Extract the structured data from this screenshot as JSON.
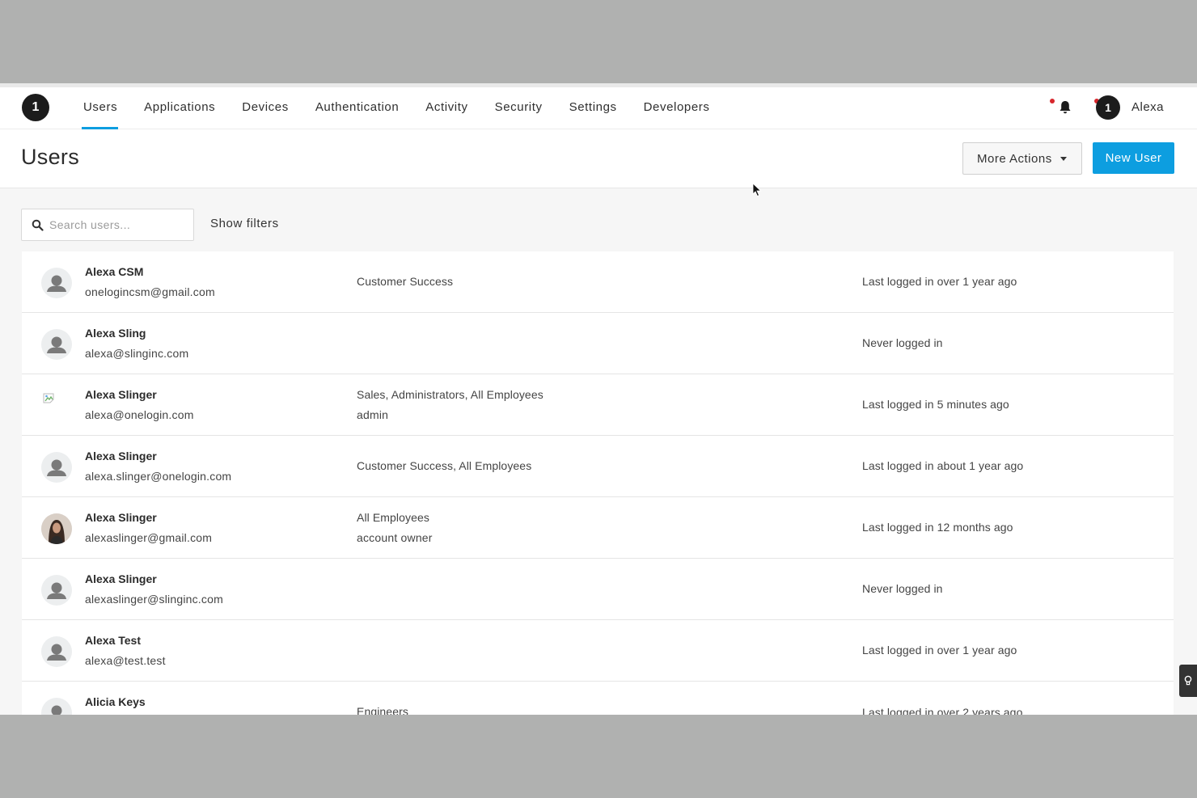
{
  "nav": {
    "logo": "1",
    "tabs": [
      {
        "label": "Users"
      },
      {
        "label": "Applications"
      },
      {
        "label": "Devices"
      },
      {
        "label": "Authentication"
      },
      {
        "label": "Activity"
      },
      {
        "label": "Security"
      },
      {
        "label": "Settings"
      },
      {
        "label": "Developers"
      }
    ],
    "active_tab": "Users",
    "user_avatar": "1",
    "user_name": "Alexa"
  },
  "header": {
    "title": "Users",
    "more_actions_label": "More Actions",
    "new_user_label": "New User"
  },
  "search": {
    "placeholder": "Search users...",
    "value": ""
  },
  "filters": {
    "label": "Show filters"
  },
  "users": [
    {
      "name": "Alexa CSM",
      "email": "onelogincsm@gmail.com",
      "groups": "Customer Success",
      "role": "",
      "login": "Last logged in over 1 year ago",
      "avatar": "placeholder"
    },
    {
      "name": "Alexa Sling",
      "email": "alexa@slinginc.com",
      "groups": "",
      "role": "",
      "login": "Never logged in",
      "avatar": "placeholder"
    },
    {
      "name": "Alexa Slinger",
      "email": "alexa@onelogin.com",
      "groups": "Sales, Administrators, All Employees",
      "role": "admin",
      "login": "Last logged in 5 minutes ago",
      "avatar": "broken-image"
    },
    {
      "name": "Alexa Slinger",
      "email": "alexa.slinger@onelogin.com",
      "groups": "Customer Success, All Employees",
      "role": "",
      "login": "Last logged in about 1 year ago",
      "avatar": "placeholder"
    },
    {
      "name": "Alexa Slinger",
      "email": "alexaslinger@gmail.com",
      "groups": "All Employees",
      "role": "account owner",
      "login": "Last logged in 12 months ago",
      "avatar": "photo"
    },
    {
      "name": "Alexa Slinger",
      "email": "alexaslinger@slinginc.com",
      "groups": "",
      "role": "",
      "login": "Never logged in",
      "avatar": "placeholder"
    },
    {
      "name": "Alexa Test",
      "email": "alexa@test.test",
      "groups": "",
      "role": "",
      "login": "Last logged in over 1 year ago",
      "avatar": "placeholder"
    },
    {
      "name": "Alicia Keys",
      "email": "",
      "groups": "Engineers",
      "role": "",
      "login": "Last logged in over 2 years ago",
      "avatar": "placeholder"
    }
  ],
  "colors": {
    "accent": "#0d9ee0",
    "notification": "#d7262c"
  },
  "icons": {
    "bell": "bell-icon",
    "search": "search-icon",
    "caret": "caret-down-icon",
    "help": "lightbulb-icon"
  }
}
